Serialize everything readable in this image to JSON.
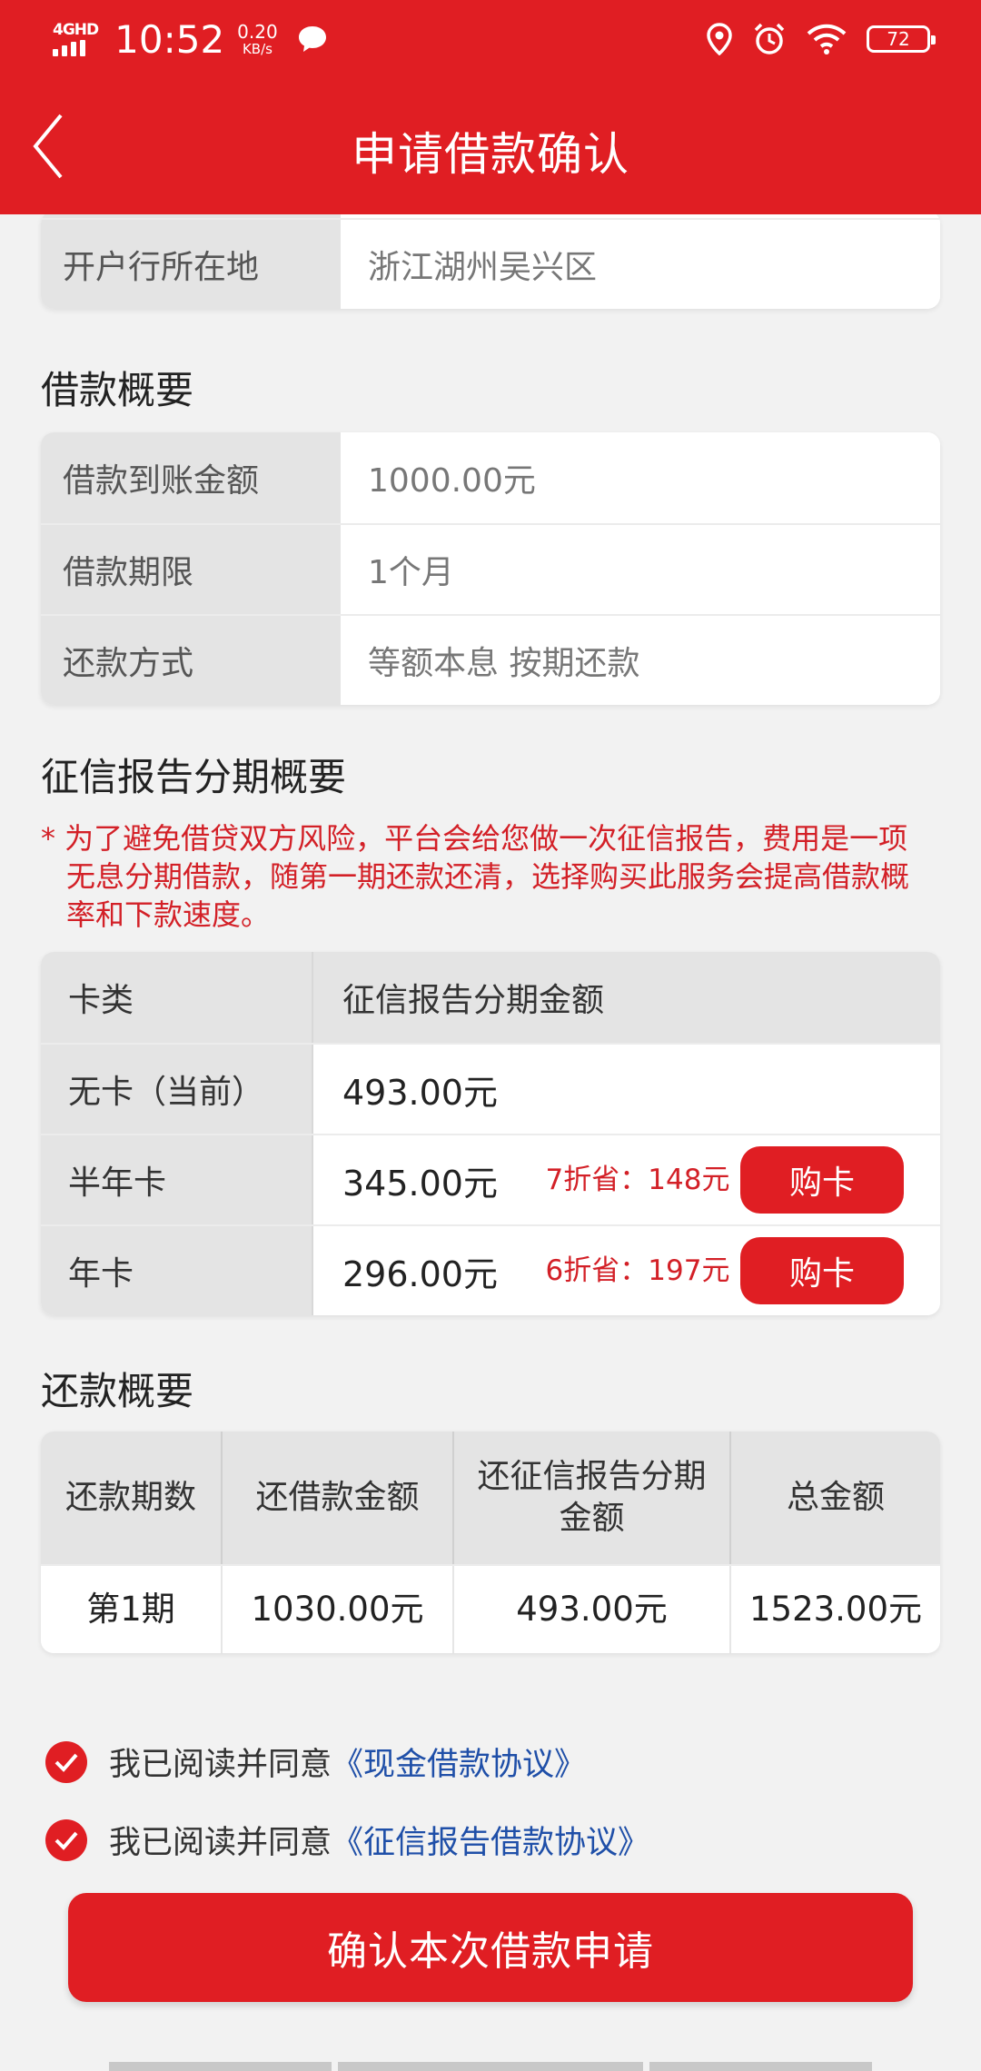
{
  "status_bar": {
    "network": "4GHD",
    "time": "10:52",
    "speed_value": "0.20",
    "speed_unit": "KB/s",
    "battery": "72"
  },
  "header": {
    "title": "申请借款确认"
  },
  "bank_info": {
    "rows": [
      {
        "label": "开户行所在地",
        "value": "浙江湖州吴兴区"
      }
    ]
  },
  "loan_summary": {
    "title": "借款概要",
    "rows": [
      {
        "label": "借款到账金额",
        "value": "1000.00元"
      },
      {
        "label": "借款期限",
        "value": "1个月"
      },
      {
        "label": "还款方式",
        "value": "等额本息 按期还款"
      }
    ]
  },
  "credit_summary": {
    "title": "征信报告分期概要",
    "notice": "* 为了避免借贷双方风险，平台会给您做一次征信报告，费用是一项无息分期借款，随第一期还款还清，选择购买此服务会提高借款概率和下款速度。",
    "header": {
      "col1": "卡类",
      "col2": "征信报告分期金额"
    },
    "rows": [
      {
        "card": "无卡（当前）",
        "price": "493.00元"
      },
      {
        "card": "半年卡",
        "price": "345.00元",
        "discount": "7折省：148元",
        "button": "购卡"
      },
      {
        "card": "年卡",
        "price": "296.00元",
        "discount": "6折省：197元",
        "button": "购卡"
      }
    ]
  },
  "repay_summary": {
    "title": "还款概要",
    "headers": [
      "还款期数",
      "还借款金额",
      "还征信报告分期金额",
      "总金额"
    ],
    "rows": [
      [
        "第1期",
        "1030.00元",
        "493.00元",
        "1523.00元"
      ]
    ]
  },
  "agreements": [
    {
      "prefix": "我已阅读并同意",
      "link": "《现金借款协议》"
    },
    {
      "prefix": "我已阅读并同意",
      "link": "《征信报告借款协议》"
    }
  ],
  "confirm_button": "确认本次借款申请",
  "colors": {
    "brand_red": "#e01e23",
    "link_blue": "#1f4fa8",
    "notice_red": "#d32027"
  }
}
